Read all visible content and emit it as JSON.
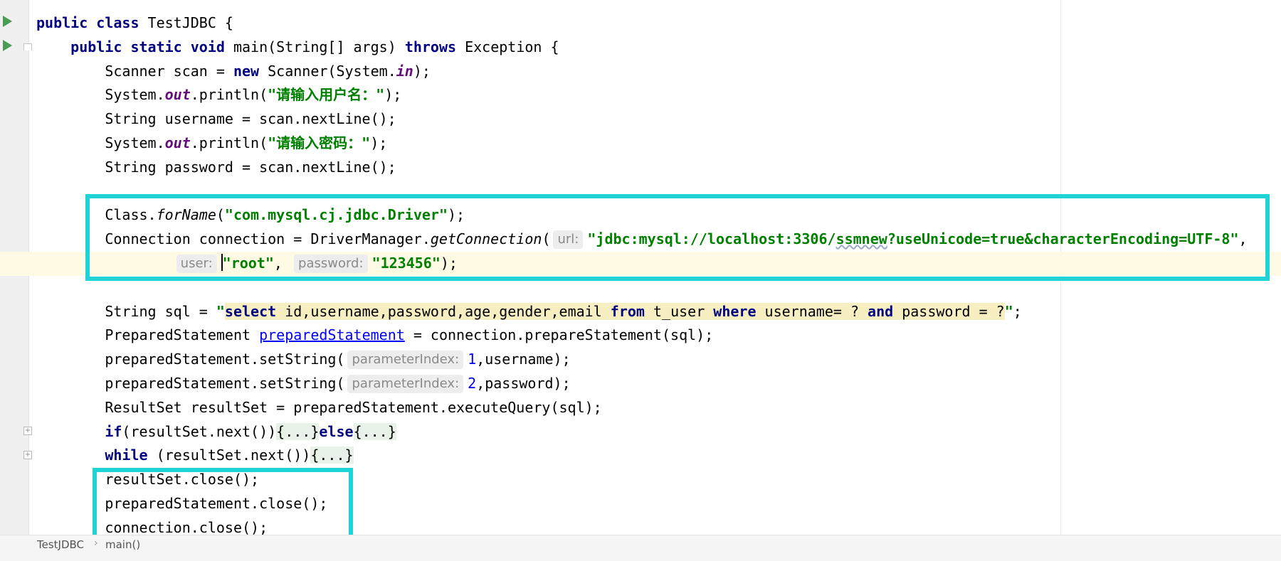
{
  "editor": {
    "lines": [
      [
        {
          "t": "public",
          "c": "kw"
        },
        {
          "t": " "
        },
        {
          "t": "class",
          "c": "kw"
        },
        {
          "t": " TestJDBC {"
        }
      ],
      [
        {
          "t": "    "
        },
        {
          "t": "public",
          "c": "kw"
        },
        {
          "t": " "
        },
        {
          "t": "static",
          "c": "kw"
        },
        {
          "t": " "
        },
        {
          "t": "void",
          "c": "kw"
        },
        {
          "t": " main(String[] args) "
        },
        {
          "t": "throws",
          "c": "kw"
        },
        {
          "t": " Exception {"
        }
      ],
      [
        {
          "t": "        Scanner scan = "
        },
        {
          "t": "new",
          "c": "kw"
        },
        {
          "t": " Scanner(System."
        },
        {
          "t": "in",
          "c": "static"
        },
        {
          "t": ");"
        }
      ],
      [
        {
          "t": "        System."
        },
        {
          "t": "out",
          "c": "static"
        },
        {
          "t": ".println("
        },
        {
          "t": "\"请输入用户名：\"",
          "c": "str"
        },
        {
          "t": ");"
        }
      ],
      [
        {
          "t": "        String username = scan.nextLine();"
        }
      ],
      [
        {
          "t": "        System."
        },
        {
          "t": "out",
          "c": "static"
        },
        {
          "t": ".println("
        },
        {
          "t": "\"请输入密码：\"",
          "c": "str"
        },
        {
          "t": ");"
        }
      ],
      [
        {
          "t": "        String password = scan.nextLine();"
        }
      ],
      [],
      [
        {
          "t": "        Class."
        },
        {
          "t": "forName",
          "c": "mtd"
        },
        {
          "t": "("
        },
        {
          "t": "\"com.mysql.cj.jdbc.Driver\"",
          "c": "str"
        },
        {
          "t": ");"
        }
      ],
      [
        {
          "t": "        Connection connection = DriverManager."
        },
        {
          "t": "getConnection",
          "c": "mtd"
        },
        {
          "t": "("
        },
        {
          "t": "url:",
          "c": "hint"
        },
        {
          "t": "\"jdbc:mysql://localhost:3306/",
          "c": "str"
        },
        {
          "t": "ssmnew",
          "c": "str squiggle"
        },
        {
          "t": "?useUnicode=true&characterEncoding=UTF-8\"",
          "c": "str"
        },
        {
          "t": ","
        }
      ],
      [
        {
          "t": "                "
        },
        {
          "t": "user:",
          "c": "hint"
        },
        {
          "t": "",
          "c": "caret"
        },
        {
          "t": "\"root\"",
          "c": "str"
        },
        {
          "t": ", "
        },
        {
          "t": "password:",
          "c": "hint"
        },
        {
          "t": "\"123456\"",
          "c": "str"
        },
        {
          "t": ");"
        }
      ],
      [],
      [
        {
          "t": "        String sql = "
        },
        {
          "t": "\"",
          "c": "str"
        },
        {
          "t": "select",
          "c": "kw inj"
        },
        {
          "t": " id,username,password,age,gender,email ",
          "c": "inj"
        },
        {
          "t": "from",
          "c": "kw inj"
        },
        {
          "t": " t_user ",
          "c": "inj"
        },
        {
          "t": "where",
          "c": "kw inj"
        },
        {
          "t": " username= ? ",
          "c": "inj"
        },
        {
          "t": "and",
          "c": "kw inj"
        },
        {
          "t": " password = ?",
          "c": "inj"
        },
        {
          "t": "\"",
          "c": "str"
        },
        {
          "t": ";"
        }
      ],
      [
        {
          "t": "        PreparedStatement "
        },
        {
          "t": "preparedStatement",
          "c": "link"
        },
        {
          "t": " = connection.prepareStatement(sql);"
        }
      ],
      [
        {
          "t": "        preparedStatement.setString("
        },
        {
          "t": "parameterIndex:",
          "c": "hint"
        },
        {
          "t": "1",
          "c": "num"
        },
        {
          "t": ",username);"
        }
      ],
      [
        {
          "t": "        preparedStatement.setString("
        },
        {
          "t": "parameterIndex:",
          "c": "hint"
        },
        {
          "t": "2",
          "c": "num"
        },
        {
          "t": ",password);"
        }
      ],
      [
        {
          "t": "        ResultSet resultSet = preparedStatement.executeQuery(sql);"
        }
      ],
      [
        {
          "t": "        "
        },
        {
          "t": "if",
          "c": "kw"
        },
        {
          "t": "(resultSet.next())"
        },
        {
          "t": "{...}",
          "c": "fold"
        },
        {
          "t": "else",
          "c": "kw"
        },
        {
          "t": "{...}",
          "c": "fold"
        }
      ],
      [
        {
          "t": "        "
        },
        {
          "t": "while",
          "c": "kw"
        },
        {
          "t": " (resultSet.next())"
        },
        {
          "t": "{...}",
          "c": "fold"
        }
      ],
      [
        {
          "t": "        resultSet.close();"
        }
      ],
      [
        {
          "t": "        preparedStatement.close();"
        }
      ],
      [
        {
          "t": "        connection.close();"
        }
      ]
    ]
  },
  "colors": {
    "keyword": "#000080",
    "string": "#008000",
    "static_field": "#660e7a",
    "number": "#0000ff",
    "annotation_box": "#1fd3d6",
    "run_icon": "#499c54"
  },
  "breadcrumb": {
    "items": [
      "TestJDBC",
      "main()"
    ],
    "separator": "›"
  }
}
